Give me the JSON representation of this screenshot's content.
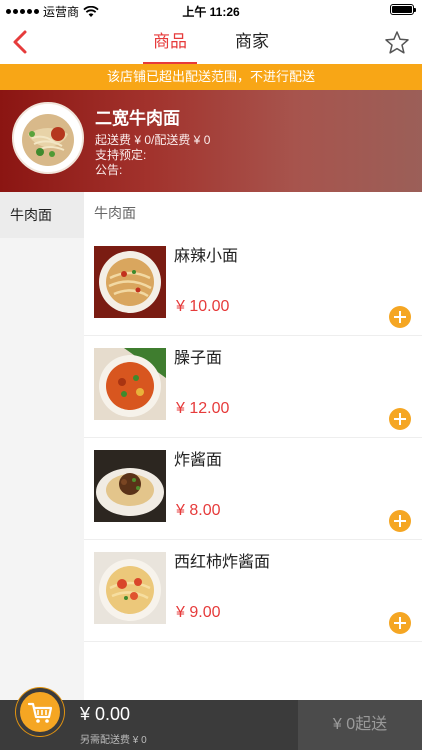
{
  "status_bar": {
    "carrier": "运营商",
    "time": "上午 11:26"
  },
  "nav": {
    "tabs": [
      {
        "label": "商品",
        "active": true
      },
      {
        "label": "商家",
        "active": false
      }
    ]
  },
  "warning": {
    "text": "该店铺已超出配送范围，不进行配送"
  },
  "shop": {
    "name": "二宽牛肉面",
    "delivery_info": "起送费 ¥ 0/配送费 ¥ 0",
    "reservation": "支持预定:",
    "notice": "公告:"
  },
  "sidebar": {
    "items": [
      {
        "label": "牛肉面",
        "selected": true
      }
    ]
  },
  "menu": {
    "section_title": "牛肉面",
    "dishes": [
      {
        "name": "麻辣小面",
        "price": "¥ 10.00",
        "image": "spicy-noodle-photo"
      },
      {
        "name": "臊子面",
        "price": "¥ 12.00",
        "image": "saozi-noodle-photo"
      },
      {
        "name": "炸酱面",
        "price": "¥ 8.00",
        "image": "zhajiang-noodle-photo"
      },
      {
        "name": "西红柿炸酱面",
        "price": "¥ 9.00",
        "image": "tomato-zhajiang-noodle-photo"
      }
    ]
  },
  "cart": {
    "total": "¥ 0.00",
    "delivery_note": "另需配送费 ¥ 0",
    "checkout_label": "¥ 0起送"
  },
  "colors": {
    "accent": "#e63b3b",
    "warning_bg": "#f8a616",
    "add_button": "#f5a623",
    "cart_bar": "#3b3b3b"
  }
}
